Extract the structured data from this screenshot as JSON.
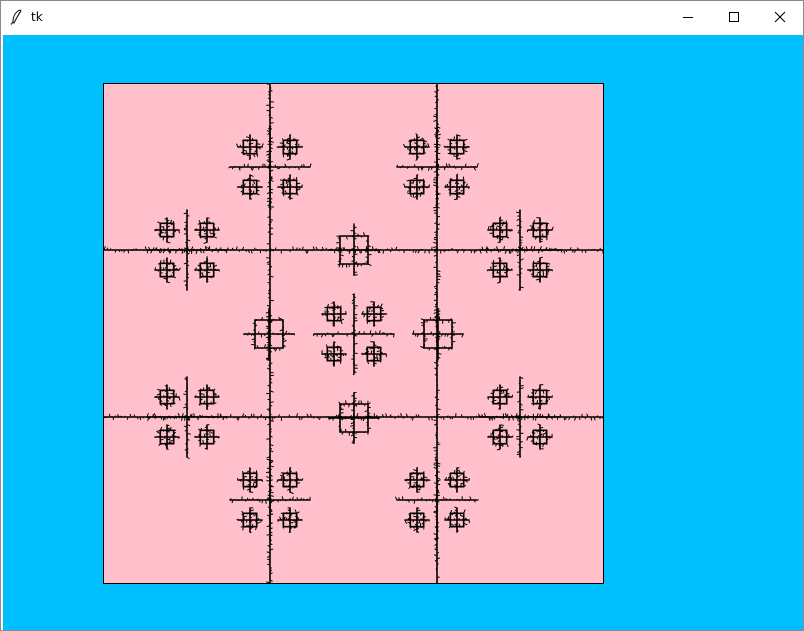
{
  "window": {
    "title": "tk",
    "icon": "feather-icon",
    "controls": [
      "minimize-icon",
      "maximize-icon",
      "close-icon"
    ]
  },
  "client": {
    "background": "#00bfff"
  },
  "canvas": {
    "background": "#ffc0cb",
    "border": "#000000",
    "drawing": "fractal-pattern",
    "stroke_color": "#000000"
  }
}
